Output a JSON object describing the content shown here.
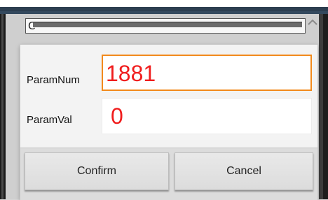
{
  "background": {
    "field_text": "C"
  },
  "dialog": {
    "param_num": {
      "label": "ParamNum",
      "value": "1881"
    },
    "param_val": {
      "label": "ParamVal",
      "value": "0"
    },
    "buttons": {
      "confirm_label": "Confirm",
      "cancel_label": "Cancel"
    }
  },
  "colors": {
    "value_text": "#f01d1d",
    "focus_border": "#f28a1c"
  },
  "icons": {
    "collapse": "chevron-up-icon"
  }
}
